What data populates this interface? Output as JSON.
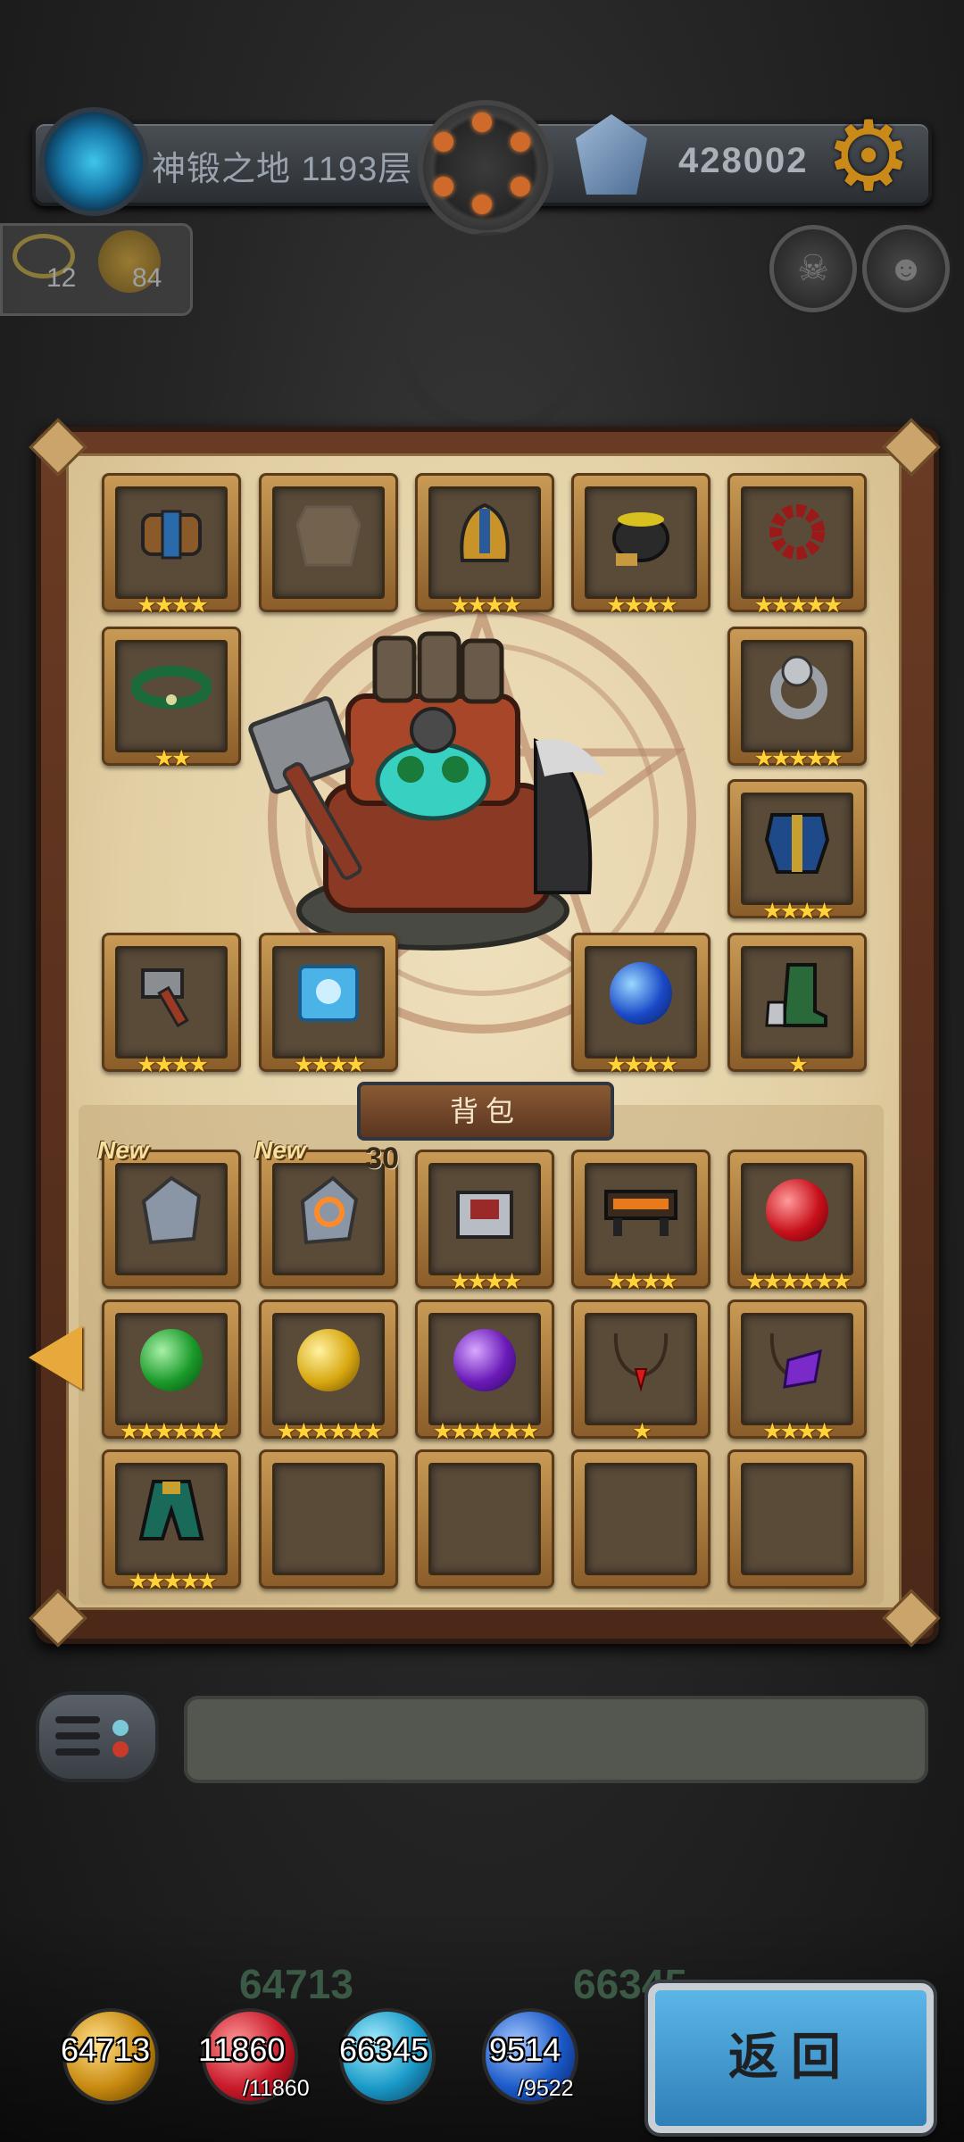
{
  "header": {
    "floor_label": "神锻之地 1193层",
    "gold_amount": "428002"
  },
  "counters": {
    "left_value": "12",
    "right_value": "84"
  },
  "equipment": {
    "slots": [
      {
        "id": "bracer",
        "icon": "bracer-icon",
        "stars": "★★★★"
      },
      {
        "id": "armor-empty",
        "icon": "armor-placeholder-icon",
        "stars": ""
      },
      {
        "id": "helmet",
        "icon": "helmet-icon",
        "stars": "★★★★"
      },
      {
        "id": "pot",
        "icon": "cauldron-icon",
        "stars": "★★★★"
      },
      {
        "id": "beads",
        "icon": "prayer-beads-icon",
        "stars": "★★★★★"
      },
      {
        "id": "band",
        "icon": "jade-bracelet-icon",
        "stars": "★★"
      },
      {
        "id": "ring",
        "icon": "silver-ring-icon",
        "stars": "★★★★★"
      },
      {
        "id": "chestplate",
        "icon": "blue-armor-icon",
        "stars": "★★★★"
      },
      {
        "id": "hammer",
        "icon": "hammer-icon",
        "stars": "★★★★"
      },
      {
        "id": "rune-tile",
        "icon": "ice-rune-icon",
        "stars": "★★★★"
      },
      {
        "id": "eye-orb",
        "icon": "blue-eye-orb-icon",
        "stars": "★★★★"
      },
      {
        "id": "boots",
        "icon": "green-boots-icon",
        "stars": "★"
      }
    ]
  },
  "bag": {
    "title": "背包",
    "items": [
      {
        "icon": "moon-rune-stone-icon",
        "stars": "",
        "new": "New",
        "qty": ""
      },
      {
        "icon": "fire-rune-stone-icon",
        "stars": "",
        "new": "New",
        "qty": "30"
      },
      {
        "icon": "silver-chest-icon",
        "stars": "★★★★",
        "new": "",
        "qty": ""
      },
      {
        "icon": "forge-anvil-icon",
        "stars": "★★★★",
        "new": "",
        "qty": ""
      },
      {
        "icon": "red-orb-icon",
        "stars": "★★★★★★",
        "new": "",
        "qty": ""
      },
      {
        "icon": "green-orb-icon",
        "stars": "★★★★★★",
        "new": "",
        "qty": ""
      },
      {
        "icon": "yellow-orb-icon",
        "stars": "★★★★★★",
        "new": "",
        "qty": ""
      },
      {
        "icon": "purple-orb-icon",
        "stars": "★★★★★★",
        "new": "",
        "qty": ""
      },
      {
        "icon": "red-gem-necklace-icon",
        "stars": "★",
        "new": "",
        "qty": ""
      },
      {
        "icon": "purple-gem-necklace-icon",
        "stars": "★★★★",
        "new": "",
        "qty": ""
      },
      {
        "icon": "jade-cloak-icon",
        "stars": "★★★★★",
        "new": "",
        "qty": ""
      }
    ]
  },
  "resources": {
    "attack": "64713",
    "hp": "11860",
    "hp_max": "/11860",
    "defense": "66345",
    "mana": "9514",
    "mana_max": "/9522"
  },
  "ghost_numbers": {
    "left": "64713",
    "right": "66345"
  },
  "return_button": "返回"
}
